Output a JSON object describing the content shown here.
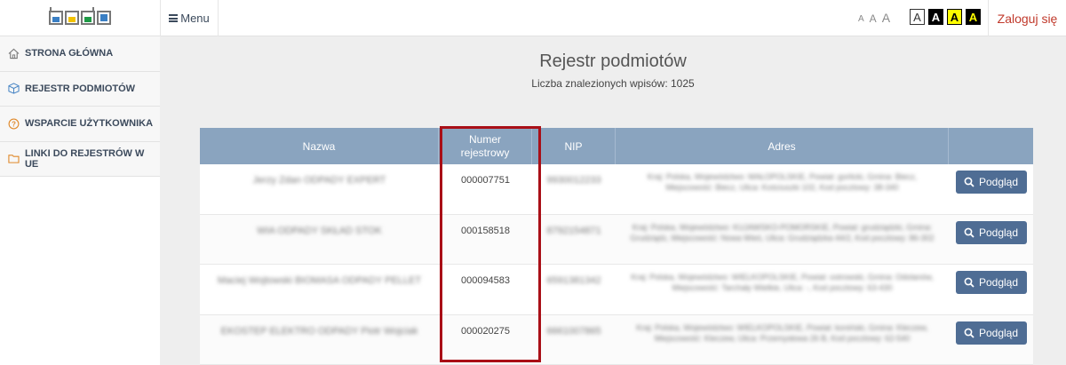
{
  "header": {
    "menu_label": "Menu",
    "font_sizes": [
      "A",
      "A",
      "A"
    ],
    "contrast_options": [
      "A",
      "A",
      "A",
      "A"
    ],
    "login_label": "Zaloguj się",
    "logo_colors": [
      "#3a7fc4",
      "#f2c200",
      "#1e9a46",
      "#3a7fc4"
    ]
  },
  "sidebar": {
    "items": [
      {
        "label": "STRONA GŁÓWNA",
        "icon": "home-icon"
      },
      {
        "label": "REJESTR PODMIOTÓW",
        "icon": "cube-icon"
      },
      {
        "label": "WSPARCIE UŻYTKOWNIKA",
        "icon": "help-icon"
      },
      {
        "label": "LINKI DO REJESTRÓW W UE",
        "icon": "folder-icon"
      }
    ]
  },
  "main": {
    "title": "Rejestr podmiotów",
    "count_label": "Liczba znalezionych wpisów: 1025",
    "columns": [
      "Nazwa",
      "Numer rejestrowy",
      "NIP",
      "Adres",
      ""
    ],
    "view_label": "Podgląd",
    "rows": [
      {
        "name": "Jerzy Zdan ODPADY EXPERT",
        "number": "000007751",
        "nip": "9930012233",
        "address": "Kraj: Polska, Województwo: MAŁOPOLSKIE, Powiat: gorlicki, Gmina: Biecz, Miejscowość: Biecz, Ulica: Kościuszki 102, Kod pocztowy: 38-340"
      },
      {
        "name": "WIA ODPADY SKŁAD STOK",
        "number": "000158518",
        "nip": "8792154871",
        "address": "Kraj: Polska, Województwo: KUJAWSKO-POMORSKIE, Powiat: grudziądzki, Gmina: Grudziądz, Miejscowość: Nowa Wieś, Ulica: Grudziądzka 44/2, Kod pocztowy: 86-302"
      },
      {
        "name": "Maciej Wojtowski BIOMASA ODPADY PELLET",
        "number": "000094583",
        "nip": "6591381342",
        "address": "Kraj: Polska, Województwo: WIELKOPOLSKIE, Powiat: ostrowski, Gmina: Odolanów, Miejscowość: Tarchały Wielkie, Ulica: -, Kod pocztowy: 63-430"
      },
      {
        "name": "EKOSTEP ELEKTRO ODPADY Piotr Wojciak",
        "number": "000020275",
        "nip": "6661007865",
        "address": "Kraj: Polska, Województwo: WIELKOPOLSKIE, Powiat: koniński, Gmina: Kleczew, Miejscowość: Kleczew, Ulica: Przemysłowa 26 B, Kod pocztowy: 62-540"
      }
    ]
  },
  "colors": {
    "accent_red": "#c0392b",
    "table_header": "#8aa4bf",
    "button": "#4f6d94",
    "highlight_border": "#a90f17"
  }
}
